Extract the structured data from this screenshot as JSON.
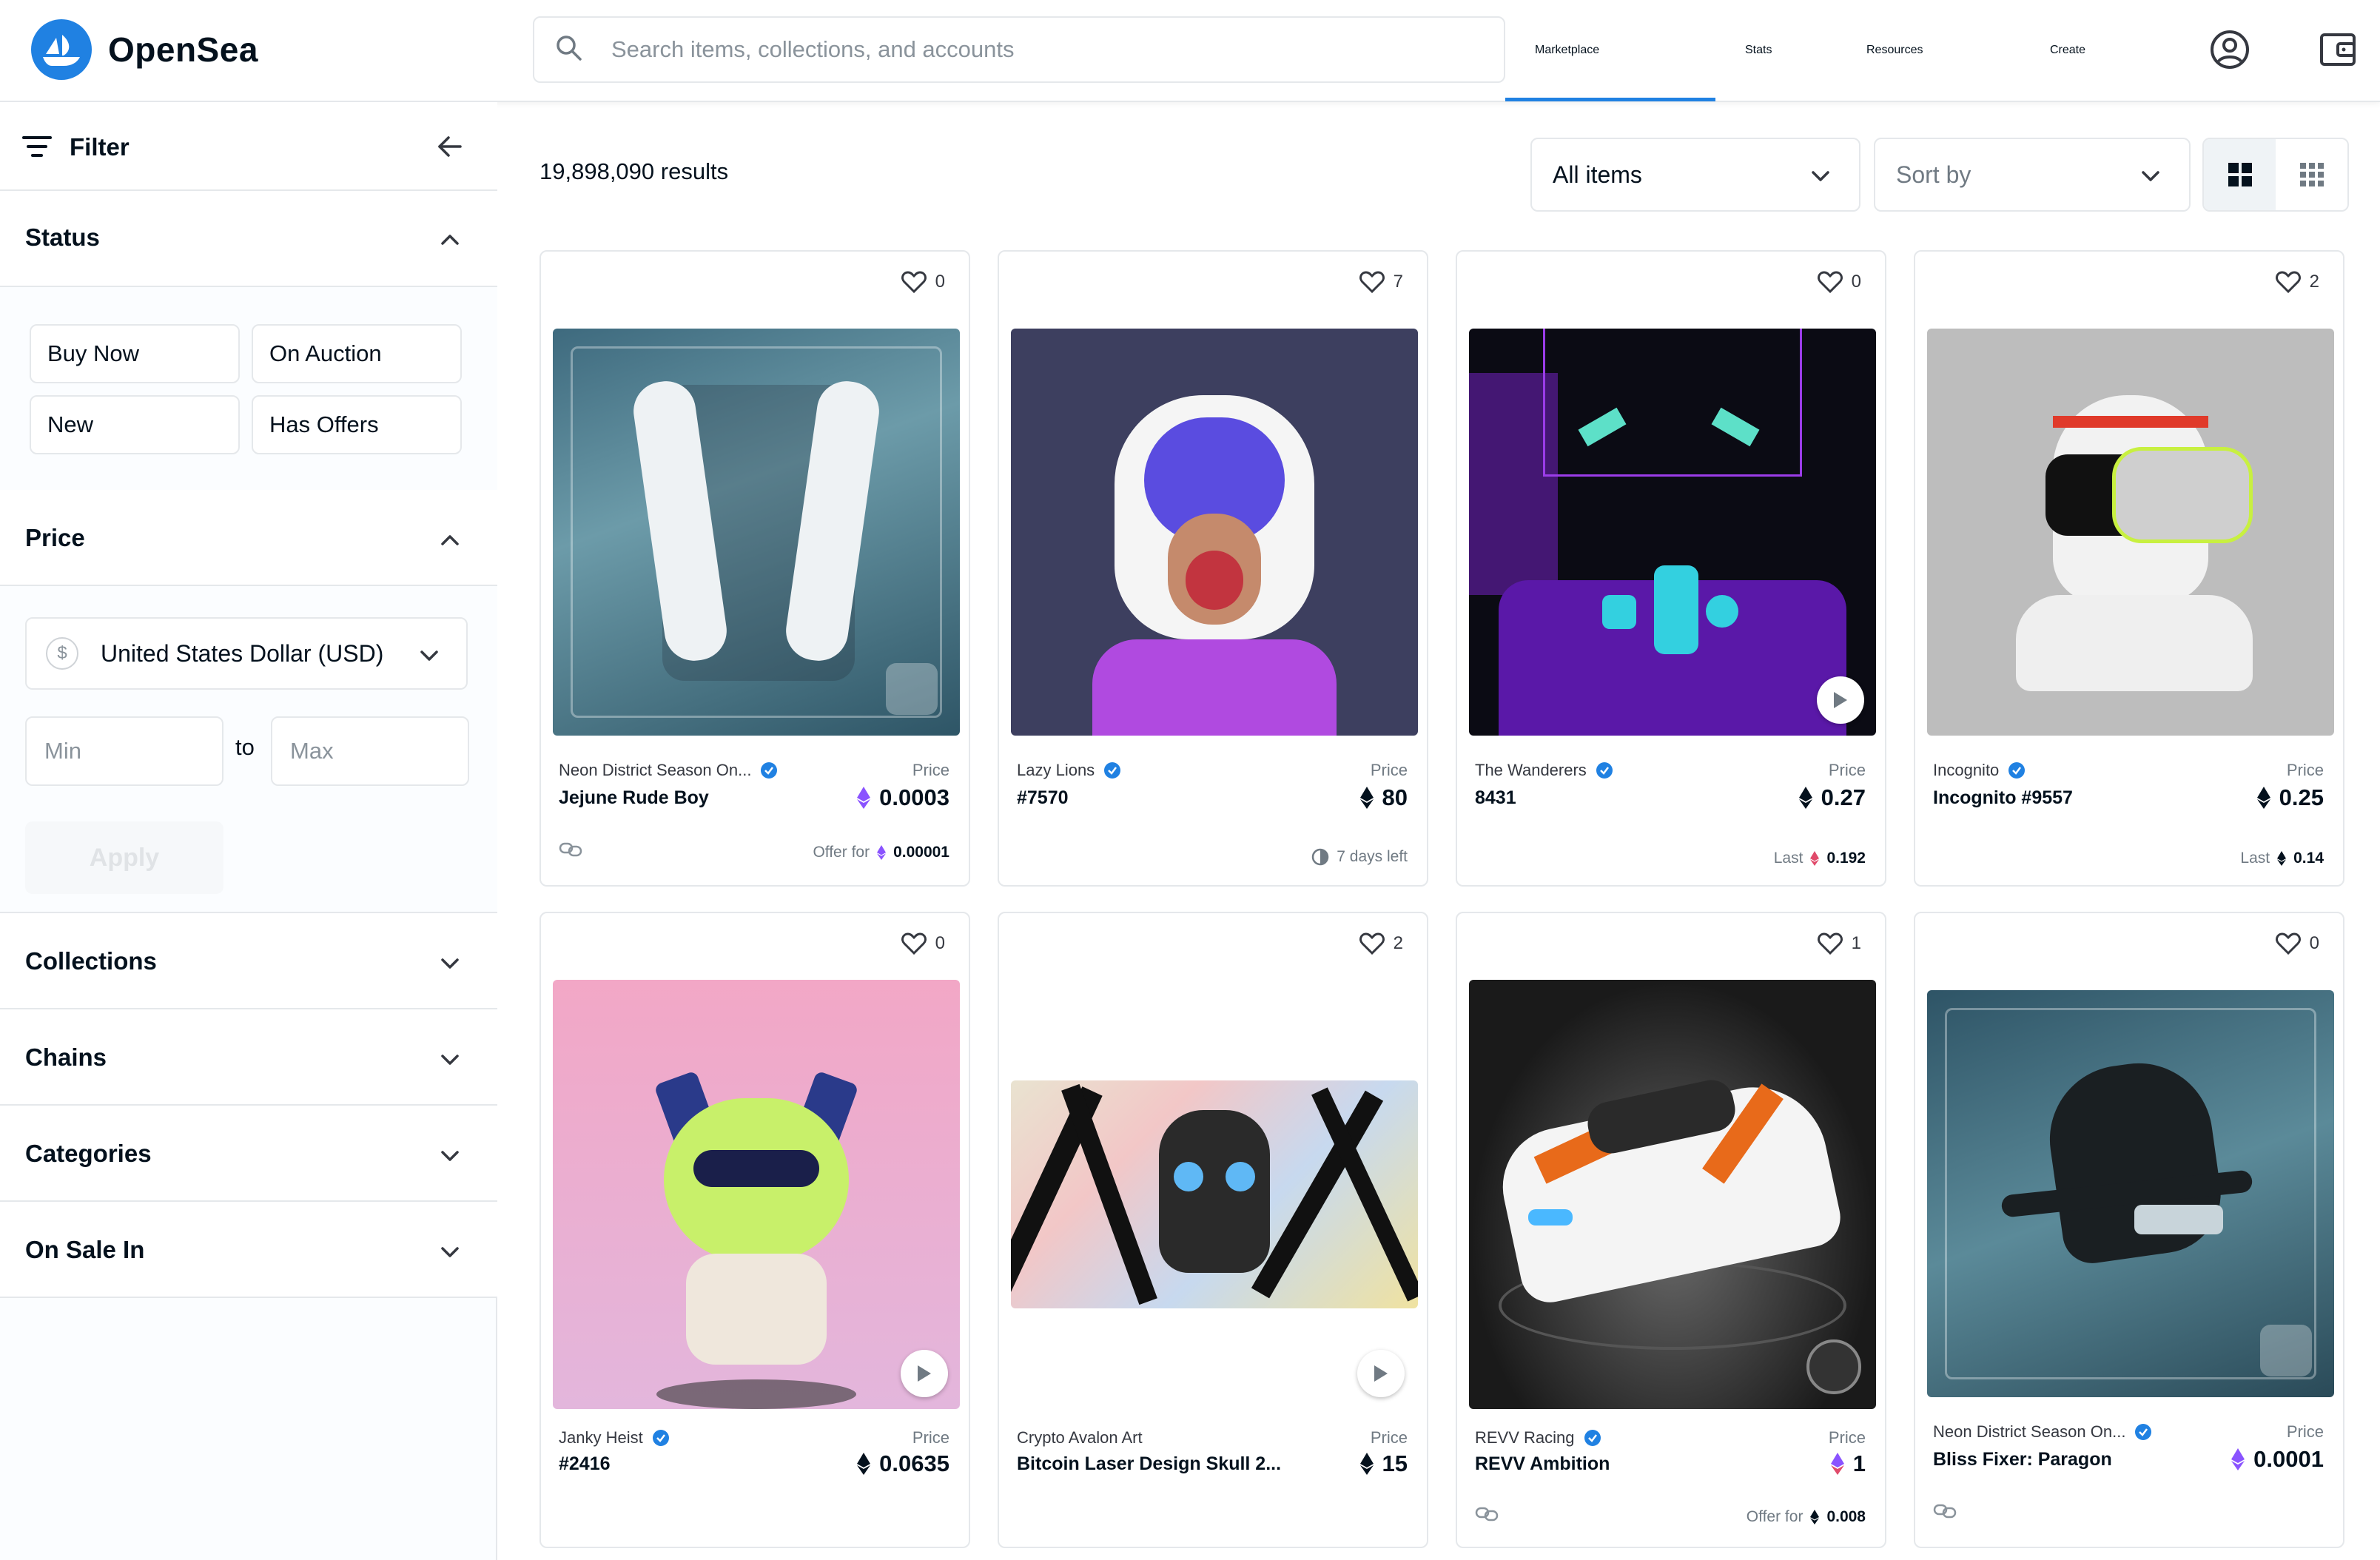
{
  "app": {
    "name": "OpenSea"
  },
  "search": {
    "placeholder": "Search items, collections, and accounts"
  },
  "nav": [
    {
      "label": "Marketplace",
      "active": true
    },
    {
      "label": "Stats"
    },
    {
      "label": "Resources"
    },
    {
      "label": "Create"
    }
  ],
  "sidebar": {
    "filter_label": "Filter",
    "status": {
      "title": "Status",
      "buttons": [
        "Buy Now",
        "On Auction",
        "New",
        "Has Offers"
      ]
    },
    "price": {
      "title": "Price",
      "currency_symbol": "$",
      "currency": "United States Dollar (USD)",
      "min_placeholder": "Min",
      "to_label": "to",
      "max_placeholder": "Max",
      "apply_label": "Apply"
    },
    "sections": [
      "Collections",
      "Chains",
      "Categories",
      "On Sale In"
    ]
  },
  "main": {
    "results": "19,898,090 results",
    "items_filter": "All items",
    "sort_placeholder": "Sort by"
  },
  "colors": {
    "accent": "#2081e2",
    "verified": "#2081e2",
    "eth": "#04111d",
    "weth": "#8a53ff"
  },
  "cards": [
    {
      "collection": "Neon District Season On...",
      "name": "Jejune Rude Boy",
      "favorites": "0",
      "price_label": "Price",
      "price": "0.0003",
      "currency": "weth",
      "footer_prefix": "Offer for",
      "footer_value": "0.00001",
      "footer_currency": "weth",
      "footer_icon": "link-icon",
      "verified": true,
      "media": "video"
    },
    {
      "collection": "Lazy Lions",
      "name": "#7570",
      "favorites": "7",
      "price_label": "Price",
      "price": "80",
      "currency": "eth",
      "footer_prefix": "",
      "footer_value": "7 days left",
      "footer_icon": "clock-icon",
      "verified": true
    },
    {
      "collection": "The Wanderers",
      "name": "8431",
      "favorites": "0",
      "price_label": "Price",
      "price": "0.27",
      "currency": "eth",
      "footer_prefix": "Last",
      "footer_value": "0.192",
      "footer_currency": "weth",
      "verified": true,
      "media": "video"
    },
    {
      "collection": "Incognito",
      "name": "Incognito #9557",
      "favorites": "2",
      "price_label": "Price",
      "price": "0.25",
      "currency": "eth",
      "footer_prefix": "Last",
      "footer_value": "0.14",
      "footer_currency": "eth",
      "verified": true
    },
    {
      "collection": "Janky Heist",
      "name": "#2416",
      "favorites": "0",
      "price_label": "Price",
      "price": "0.0635",
      "currency": "eth",
      "verified": true,
      "media": "video"
    },
    {
      "collection": "Crypto Avalon Art",
      "name": "Bitcoin Laser Design Skull 2...",
      "favorites": "2",
      "price_label": "Price",
      "price": "15",
      "currency": "eth",
      "verified": false,
      "media": "video"
    },
    {
      "collection": "REVV Racing",
      "name": "REVV Ambition",
      "favorites": "1",
      "price_label": "Price",
      "price": "1",
      "currency": "weth",
      "footer_prefix": "Offer for",
      "footer_value": "0.008",
      "footer_currency": "eth",
      "footer_icon": "link-icon",
      "verified": true
    },
    {
      "collection": "Neon District Season On...",
      "name": "Bliss Fixer: Paragon",
      "favorites": "0",
      "price_label": "Price",
      "price": "0.0001",
      "currency": "weth",
      "footer_icon": "link-icon",
      "verified": true
    }
  ]
}
